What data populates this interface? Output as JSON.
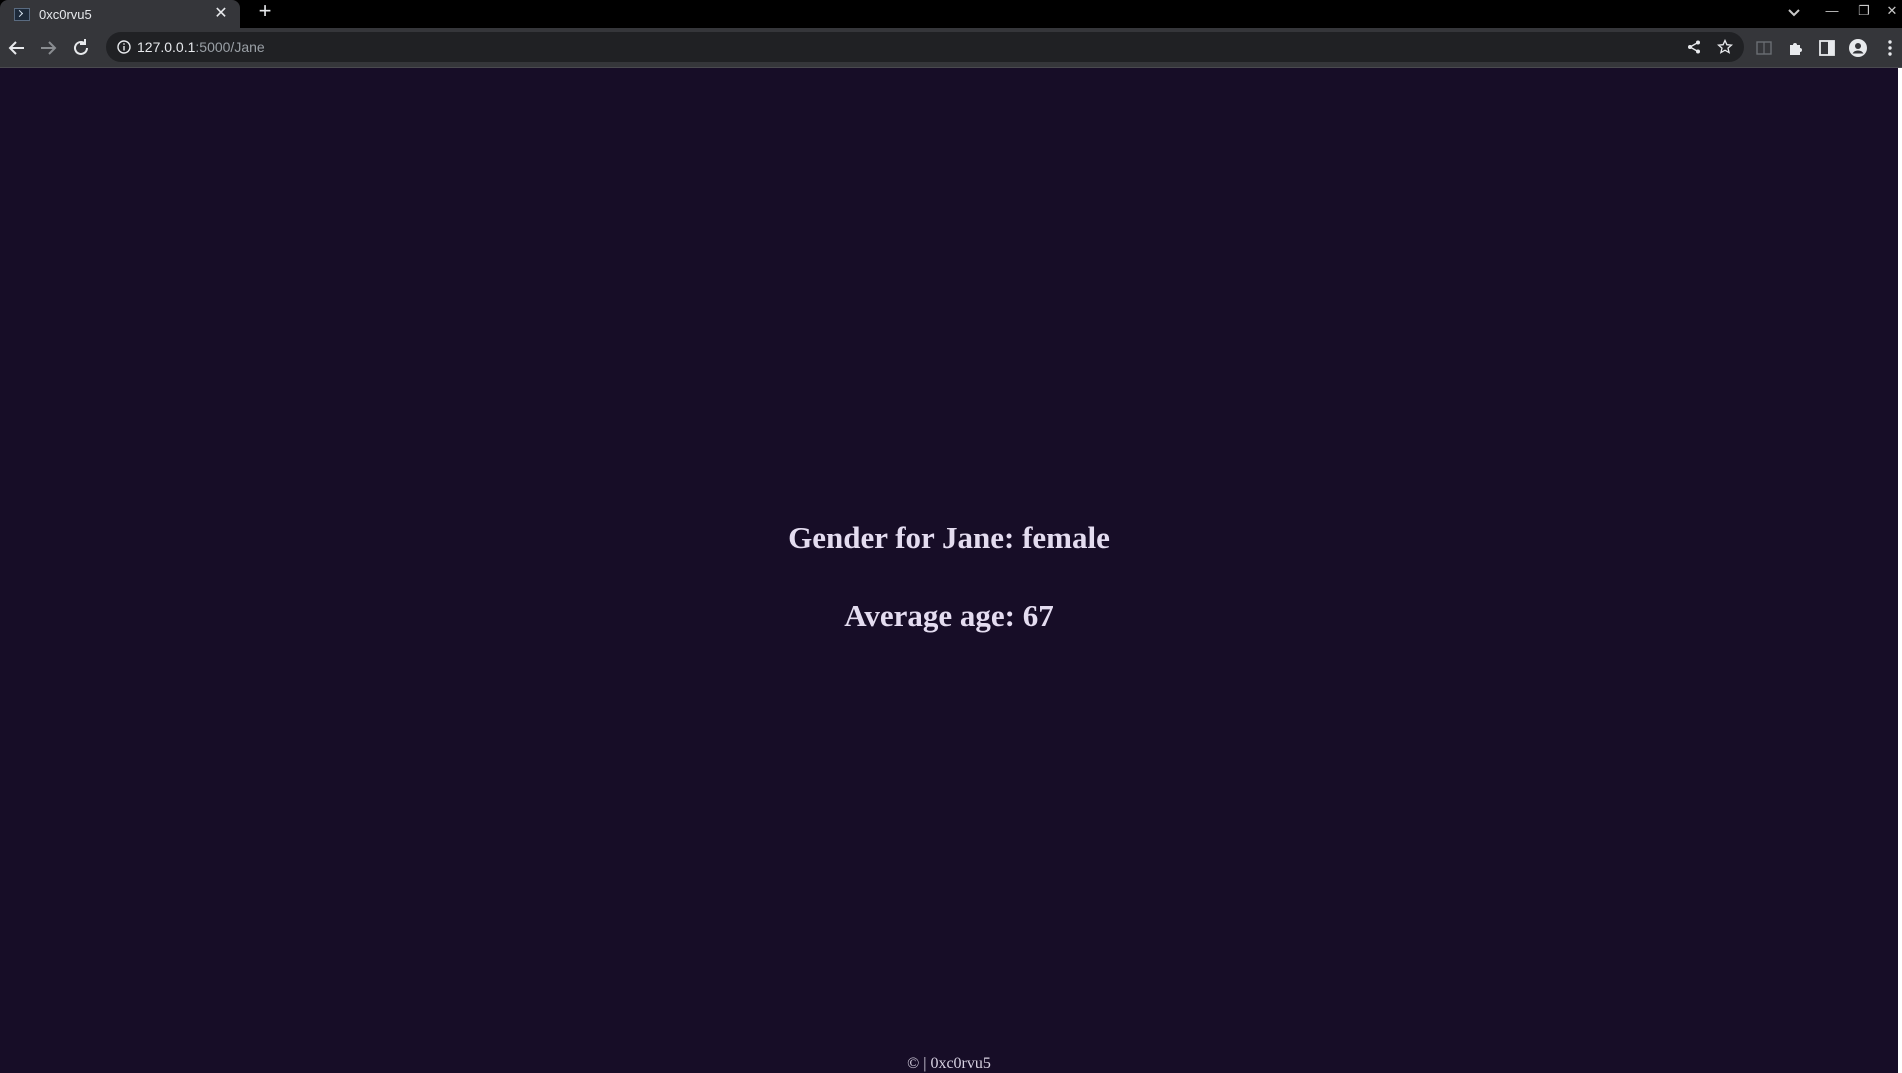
{
  "browser": {
    "tab": {
      "title": "0xc0rvu5",
      "close_glyph": "✕",
      "favicon": "terminal-icon"
    },
    "new_tab_glyph": "+",
    "address": {
      "host": "127.0.0.1",
      "rest": ":5000/Jane"
    },
    "window_controls": {
      "minimize": "—",
      "restore": "❐",
      "close": "✕"
    }
  },
  "page": {
    "gender_line": "Gender for Jane: female",
    "age_line": "Average age: 67",
    "footer": "© | 0xc0rvu5"
  },
  "colors": {
    "page_background": "#170d27",
    "heading_text": "#e4dcf0",
    "browser_chrome": "#35363a"
  }
}
